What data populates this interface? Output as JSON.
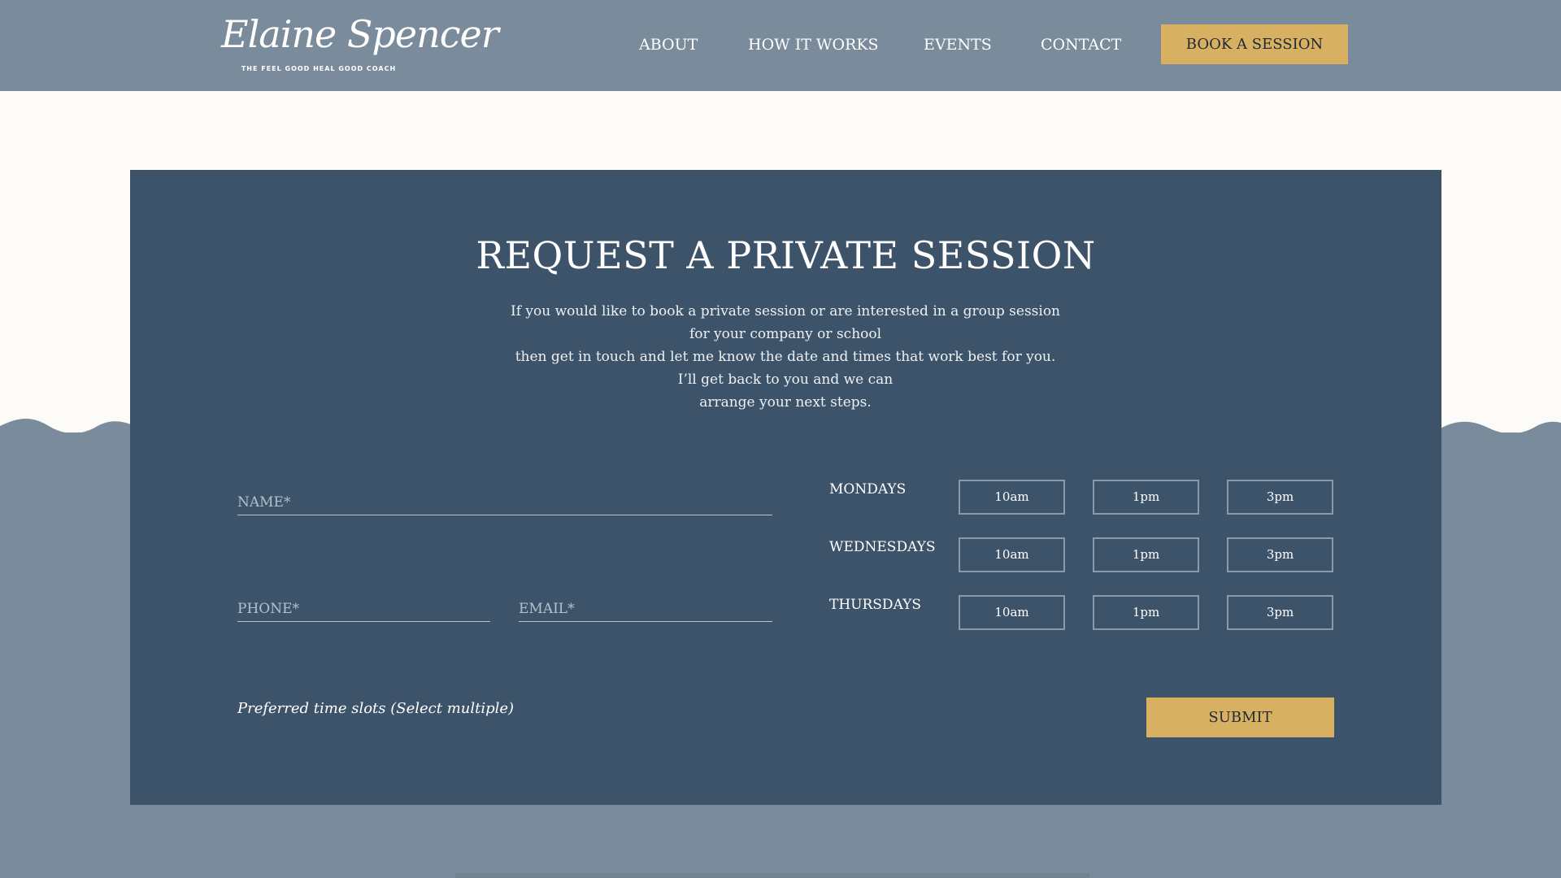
{
  "brand": {
    "name": "Elaine Spencer",
    "tagline": "THE FEEL GOOD HEAL GOOD COACH"
  },
  "nav": {
    "items": [
      {
        "label": "ABOUT"
      },
      {
        "label": "HOW IT WORKS"
      },
      {
        "label": "EVENTS"
      },
      {
        "label": "CONTACT"
      }
    ],
    "cta_label": "BOOK A SESSION"
  },
  "form": {
    "title": "REQUEST A PRIVATE SESSION",
    "description": [
      "If you would like to book a private session or are interested in a group session",
      "for your company or school",
      "then get in touch and let me know the date and times that work best for you.",
      "I’ll get back to you and we can",
      "arrange your next steps."
    ],
    "name_placeholder": "NAME*",
    "phone_placeholder": "PHONE*",
    "email_placeholder": "EMAIL*",
    "days": [
      {
        "label": "MONDAYS",
        "slots": [
          "10am",
          "1pm",
          "3pm"
        ]
      },
      {
        "label": "WEDNESDAYS",
        "slots": [
          "10am",
          "1pm",
          "3pm"
        ]
      },
      {
        "label": "THURSDAYS",
        "slots": [
          "10am",
          "1pm",
          "3pm"
        ]
      }
    ],
    "hint": "Preferred time slots (Select multiple)",
    "submit_label": "SUBMIT"
  },
  "colors": {
    "header_bg": "#7a8b9b",
    "light_bg": "#fcfbf8",
    "panel_bg": "#3d536a",
    "accent_gold": "#d8b061"
  }
}
